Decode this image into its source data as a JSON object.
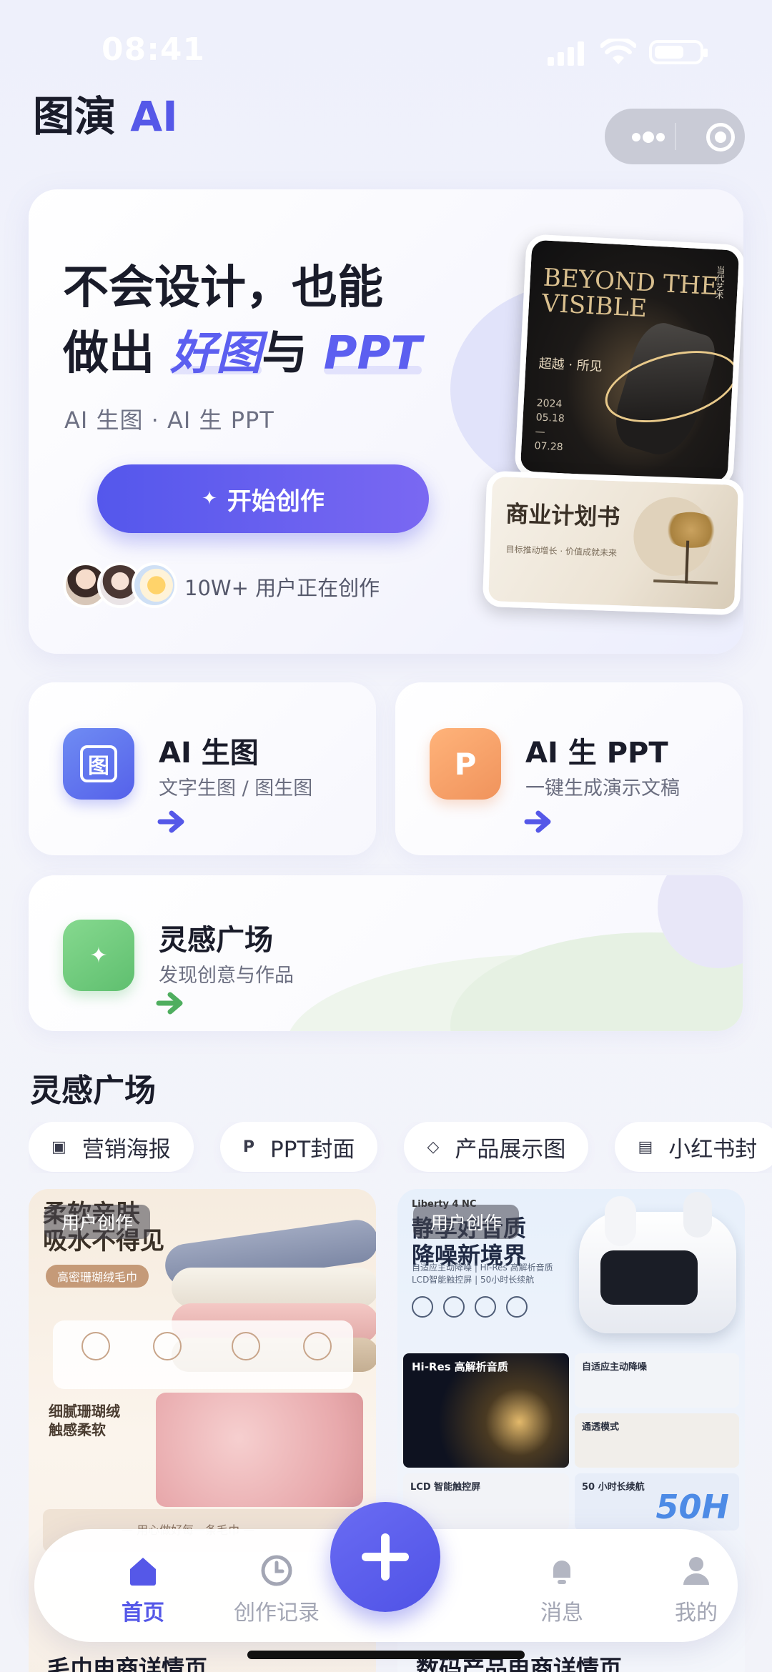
{
  "status_bar": {
    "time": "08:41"
  },
  "header": {
    "brand_main": "图演",
    "brand_ai": "AI"
  },
  "hero": {
    "headline_line1": "不会设计，也能",
    "headline_prefix": "做出",
    "headline_accent1": "好图",
    "headline_conj": "与",
    "headline_accent2": "PPT",
    "subtitle": "AI 生图 · AI 生 PPT",
    "cta_label": "开始创作",
    "cta_icon": "sparkle-icon",
    "users_text": "10W+ 用户正在创作",
    "poster1": {
      "title": "BEYOND THE VISIBLE",
      "subtitle": "超越 · 所见",
      "dates": "2024\n05.18\n—\n07.28",
      "side_text": "当代艺术"
    },
    "poster2": {
      "title": "商业计划书",
      "subtitle": "目标推动增长 · 价值成就未来"
    }
  },
  "features": {
    "gen": {
      "icon_glyph": "图",
      "title": "AI 生图",
      "subtitle": "文字生图 / 图生图"
    },
    "ppt": {
      "icon_glyph": "P",
      "title": "AI 生 PPT",
      "subtitle": "一键生成演示文稿"
    },
    "inspiration": {
      "icon_glyph": "✦",
      "title": "灵感广场",
      "subtitle": "发现创意与作品"
    }
  },
  "section": {
    "title": "灵感广场"
  },
  "chips": [
    {
      "icon": "▣",
      "label": "营销海报"
    },
    {
      "icon": "P",
      "label": "PPT封面"
    },
    {
      "icon": "◇",
      "label": "产品展示图"
    },
    {
      "icon": "▤",
      "label": "小红书封"
    }
  ],
  "gallery": {
    "left": {
      "badge": "用户创作",
      "headline": "柔软亲肤\n吸水不得见",
      "pill": "高密珊瑚绒毛巾",
      "sub": "细腻珊瑚绒\n触感柔软",
      "strip": "— 用心做好每一条毛巾 —",
      "caption": "毛巾电商详情页"
    },
    "right": {
      "badge": "用户创作",
      "brand": "Liberty 4 NC",
      "headline": "静享好音质\n降噪新境界",
      "line": "自适应主动降噪 | Hi-Res 高解析音质\nLCD智能触控屏 | 50小时长续航",
      "p1": "Hi-Res 高解析音质",
      "p2": "自适应主动降噪",
      "p3": "通透模式",
      "p4": "LCD 智能触控屏",
      "p5": "50 小时长续航",
      "p5_big": "50H",
      "caption": "数码产品电商详情页"
    }
  },
  "tabbar": {
    "home": "首页",
    "history": "创作记录",
    "messages": "消息",
    "me": "我的"
  },
  "colors": {
    "accent": "#5558e8",
    "green": "#5fbf6f",
    "orange": "#f0935c"
  }
}
